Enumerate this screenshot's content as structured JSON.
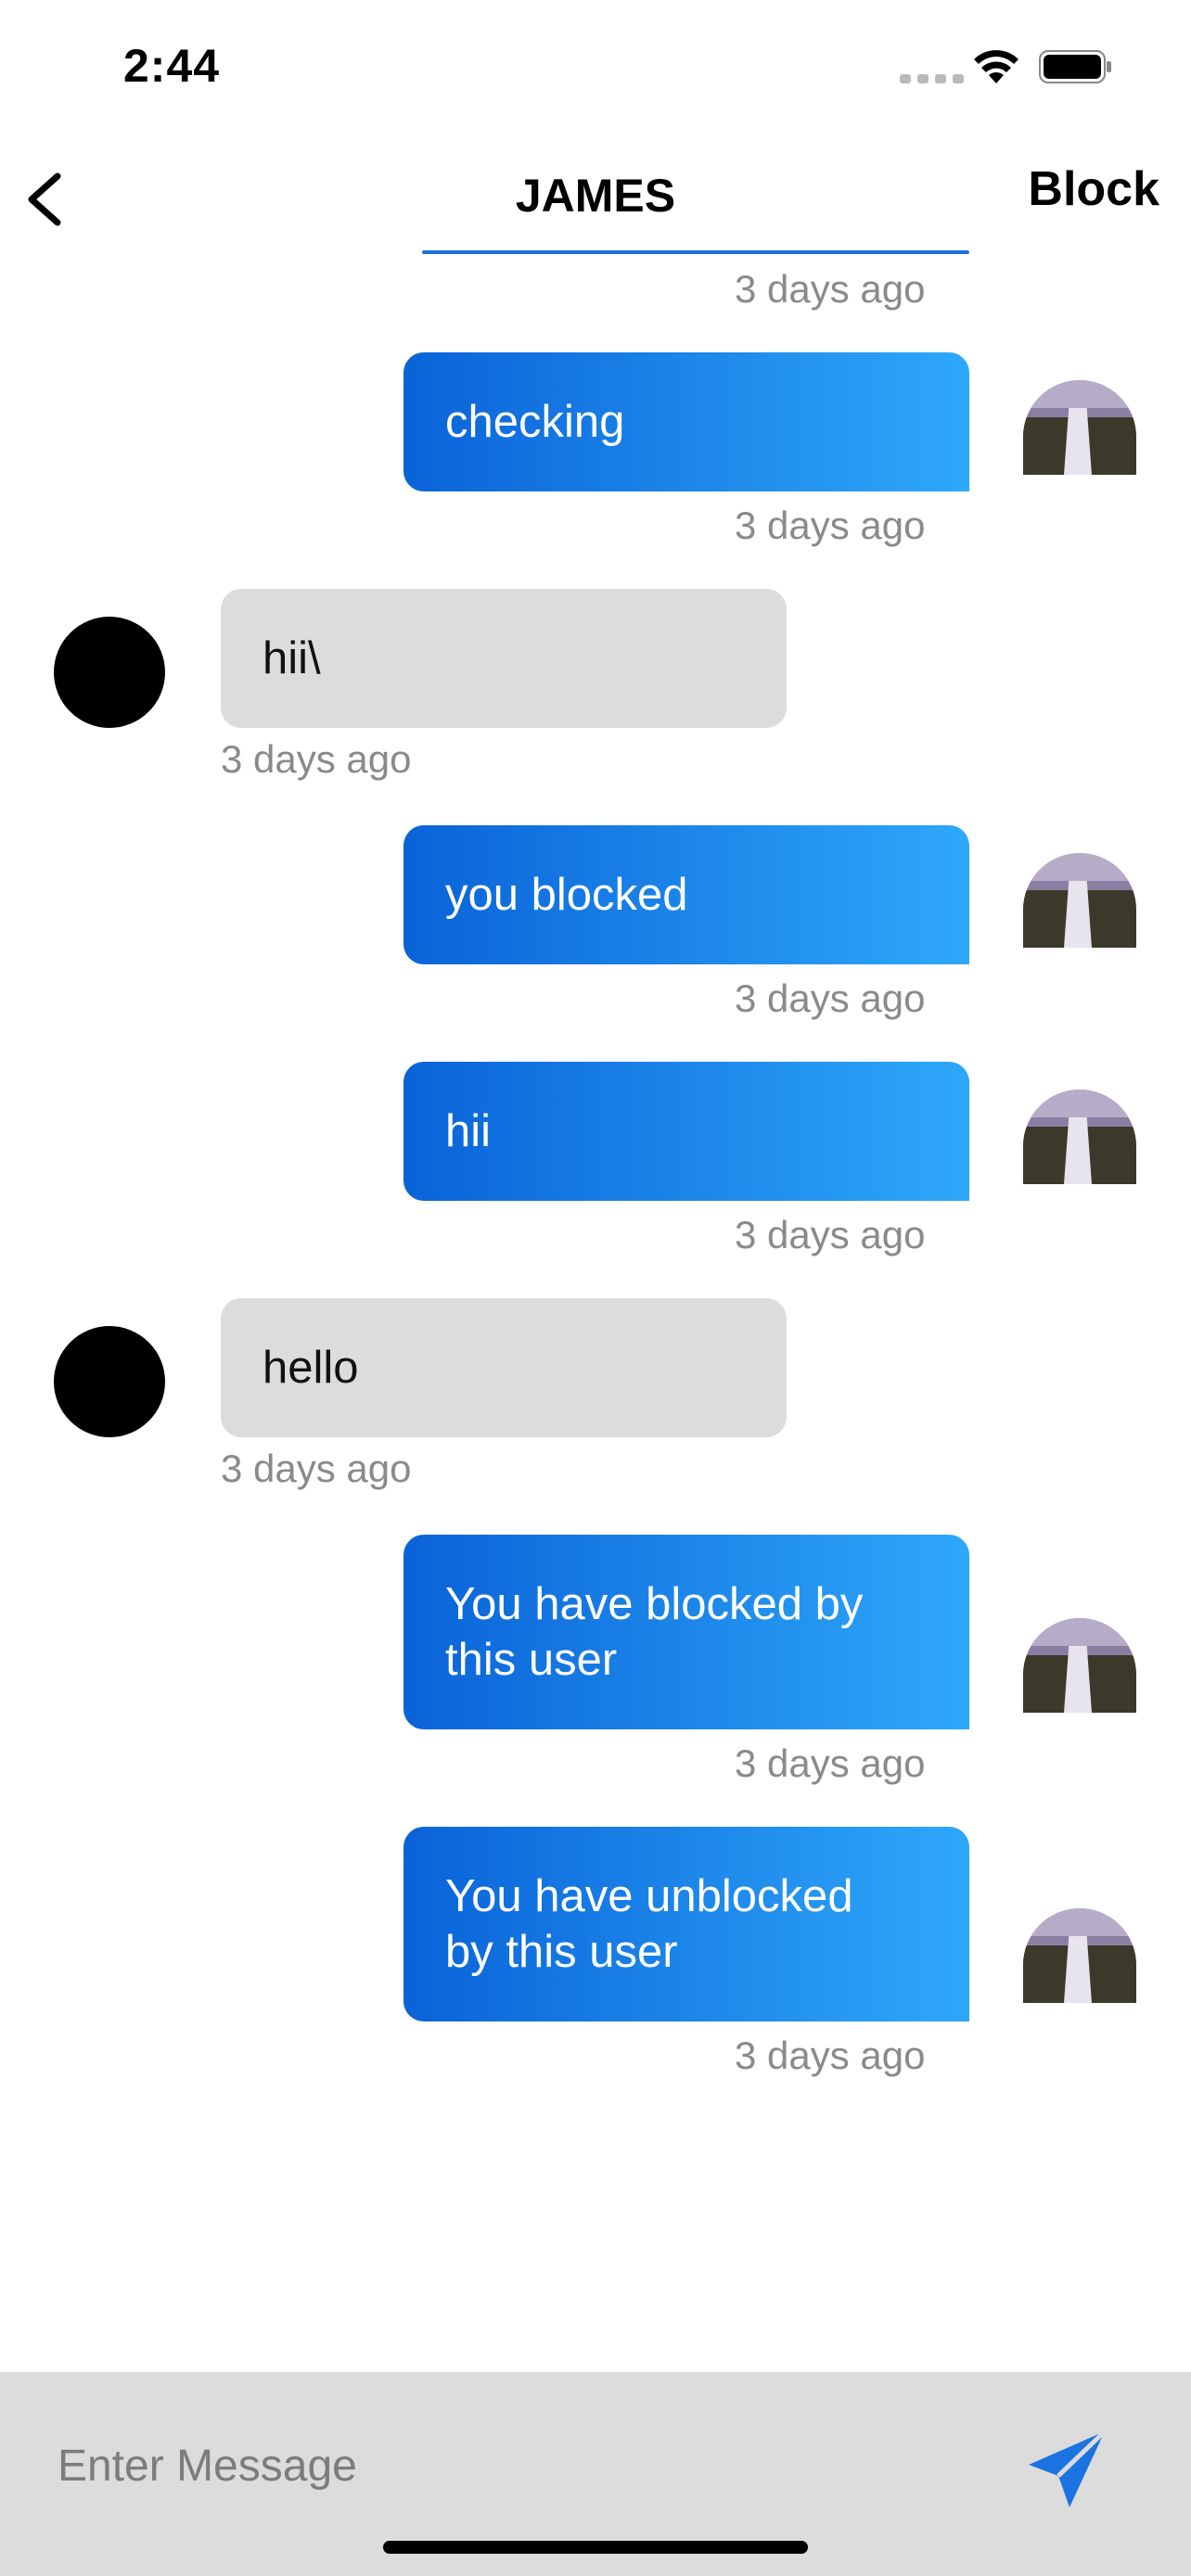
{
  "status_bar": {
    "time": "2:44",
    "icons": [
      "cellular-icon",
      "wifi-icon",
      "battery-icon"
    ]
  },
  "header": {
    "back_icon": "chevron-left-icon",
    "title": "JAMES",
    "block_label": "Block"
  },
  "colors": {
    "outgoing_start": "#0a63d8",
    "outgoing_end": "#2ea8fa",
    "incoming": "#dcdcdc",
    "timestamp": "#8a8a8a",
    "accent": "#1a73e0"
  },
  "top_timestamp": "3 days ago",
  "messages": [
    {
      "sender": "me",
      "lines": [
        "checking"
      ],
      "time": "3 days ago"
    },
    {
      "sender": "them",
      "lines": [
        "hii\\"
      ],
      "time": "3 days ago"
    },
    {
      "sender": "me",
      "lines": [
        "you blocked"
      ],
      "time": "3 days ago"
    },
    {
      "sender": "me",
      "lines": [
        "hii"
      ],
      "time": "3 days ago"
    },
    {
      "sender": "them",
      "lines": [
        "hello"
      ],
      "time": "3 days ago"
    },
    {
      "sender": "me",
      "lines": [
        "You have blocked by",
        "this user"
      ],
      "time": "3 days ago"
    },
    {
      "sender": "me",
      "lines": [
        "You have unblocked",
        "by this user"
      ],
      "time": "3 days ago"
    }
  ],
  "composer": {
    "placeholder": "Enter Message",
    "send_icon": "send-icon"
  }
}
